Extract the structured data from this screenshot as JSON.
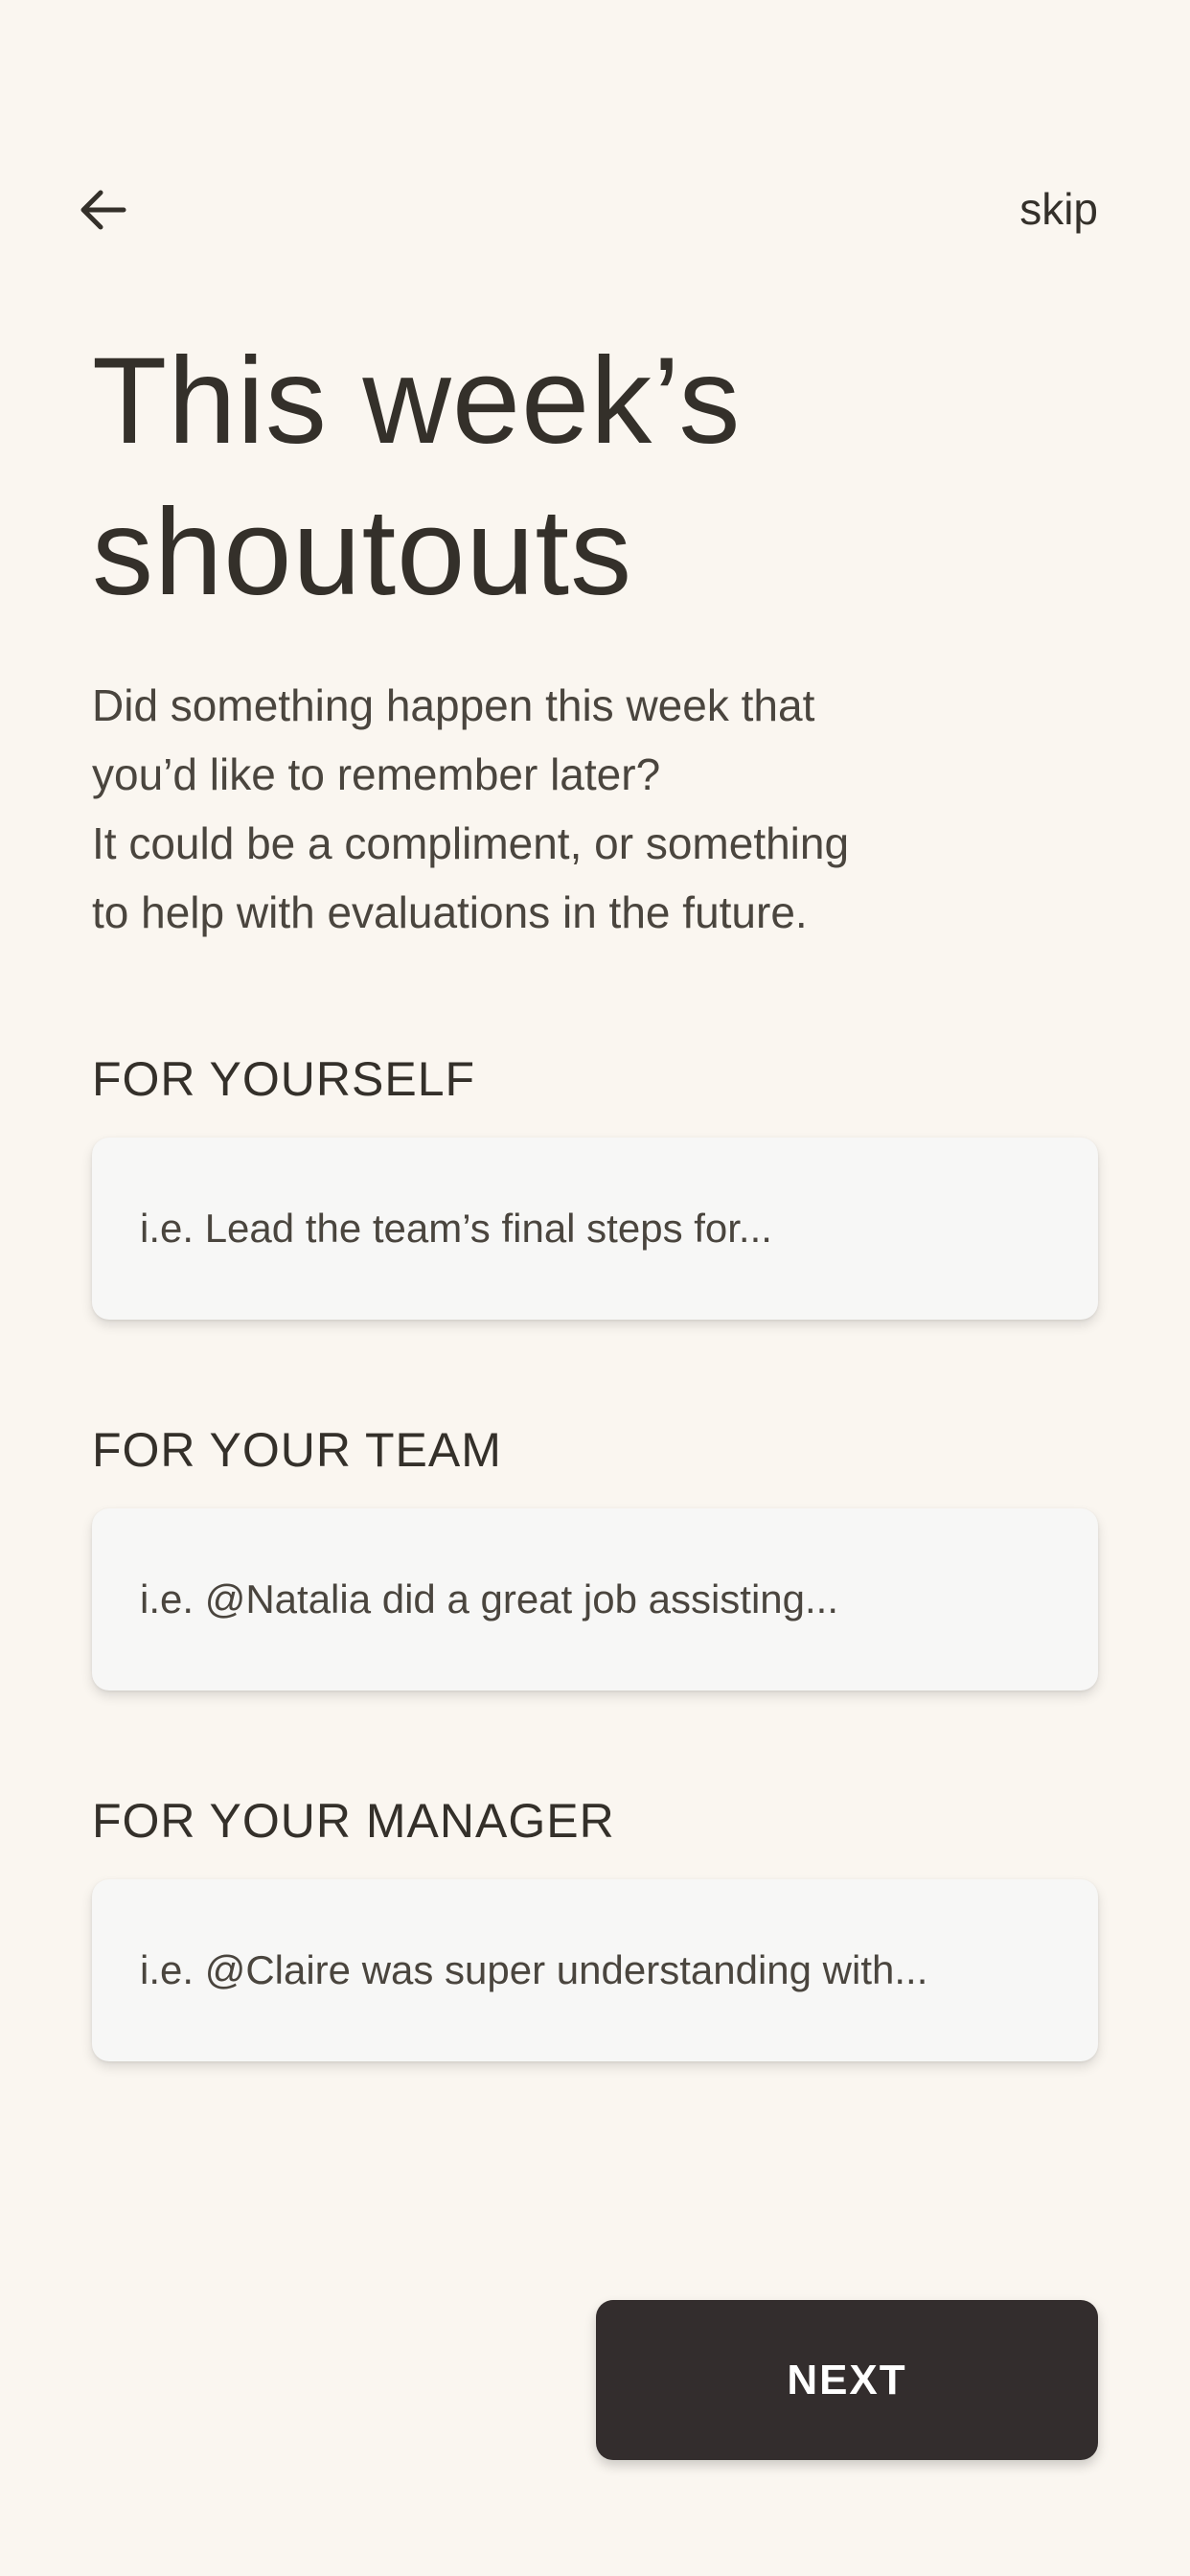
{
  "header": {
    "back_icon": "arrow-left-icon",
    "skip_label": "skip"
  },
  "title": {
    "line1": "This week’s",
    "line2": "shoutouts"
  },
  "intro": {
    "line1": "Did something happen this week that",
    "line2": "you’d like to remember later?",
    "line3": "It could be a compliment, or something",
    "line4": "to help with evaluations in the future."
  },
  "sections": {
    "yourself": {
      "label": "FOR YOURSELF",
      "placeholder": "i.e. Lead the team’s final steps for...",
      "value": ""
    },
    "team": {
      "label": "FOR YOUR TEAM",
      "placeholder": "i.e. @Natalia did a great job assisting...",
      "value": ""
    },
    "manager": {
      "label": "FOR YOUR MANAGER",
      "placeholder": "i.e. @Claire was super understanding with...",
      "value": ""
    }
  },
  "next_label": "NEXT",
  "colors": {
    "background": "#faf6f0",
    "text": "#34302a",
    "field_bg": "#f7f7f6",
    "button_bg": "#332d2d",
    "button_text": "#ffffff"
  }
}
